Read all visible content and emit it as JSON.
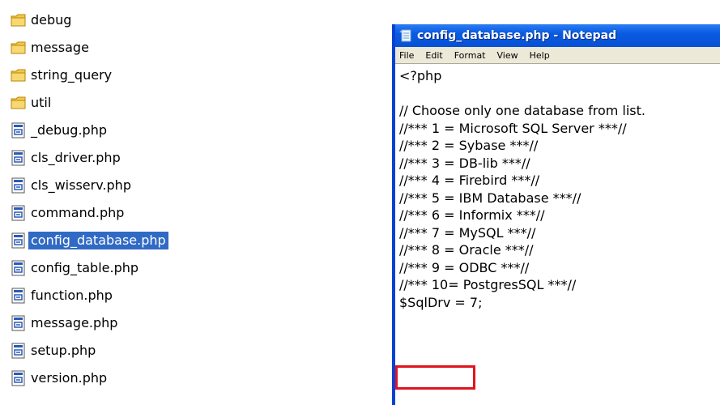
{
  "explorer": {
    "items": [
      {
        "label": "debug",
        "type": "folder",
        "icon": "folder-icon",
        "selected": false
      },
      {
        "label": "message",
        "type": "folder",
        "icon": "folder-icon",
        "selected": false
      },
      {
        "label": "string_query",
        "type": "folder",
        "icon": "folder-icon",
        "selected": false
      },
      {
        "label": "util",
        "type": "folder",
        "icon": "folder-icon",
        "selected": false
      },
      {
        "label": "_debug.php",
        "type": "file",
        "icon": "php-file-icon",
        "selected": false
      },
      {
        "label": "cls_driver.php",
        "type": "file",
        "icon": "php-file-icon",
        "selected": false
      },
      {
        "label": "cls_wisserv.php",
        "type": "file",
        "icon": "php-file-icon",
        "selected": false
      },
      {
        "label": "command.php",
        "type": "file",
        "icon": "php-file-icon",
        "selected": false
      },
      {
        "label": "config_database.php",
        "type": "file",
        "icon": "php-file-icon",
        "selected": true
      },
      {
        "label": "config_table.php",
        "type": "file",
        "icon": "php-file-icon",
        "selected": false
      },
      {
        "label": "function.php",
        "type": "file",
        "icon": "php-file-icon",
        "selected": false
      },
      {
        "label": "message.php",
        "type": "file",
        "icon": "php-file-icon",
        "selected": false
      },
      {
        "label": "setup.php",
        "type": "file",
        "icon": "php-file-icon",
        "selected": false
      },
      {
        "label": "version.php",
        "type": "file",
        "icon": "php-file-icon",
        "selected": false
      }
    ],
    "selection_color": "#316ac5"
  },
  "notepad": {
    "title": "config_database.php - Notepad",
    "menu": [
      "File",
      "Edit",
      "Format",
      "View",
      "Help"
    ],
    "lines": [
      "<?php",
      "",
      "// Choose only one database from list.",
      "//*** 1 = Microsoft SQL Server ***//",
      "//*** 2 = Sybase ***//",
      "//*** 3 = DB-lib ***//",
      "//*** 4 = Firebird ***//",
      "//*** 5 = IBM Database ***//",
      "//*** 6 = Informix ***//",
      "//*** 7 = MySQL ***//",
      "//*** 8 = Oracle ***//",
      "//*** 9 = ODBC ***//",
      "//*** 10= PostgresSQL ***//",
      "$SqlDrv = 7;"
    ],
    "highlight_color": "#e0141e",
    "titlebar_color": "#0a5be0"
  }
}
